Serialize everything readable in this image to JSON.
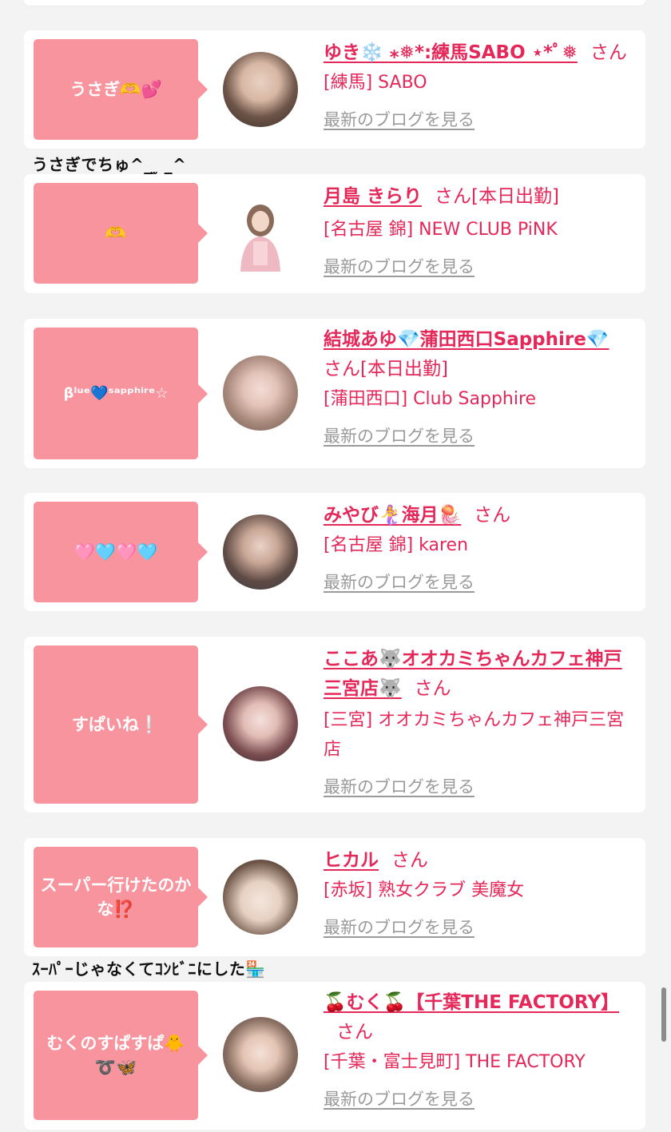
{
  "cards": [
    {
      "bubble": "うさぎ🫶💕",
      "name": "ゆき❄️ ⁎❅*:練馬SABO ⋆*ﾟ❅",
      "san": "さん",
      "status": "",
      "shop": "[練馬] SABO",
      "blog": "最新のブログを見る",
      "comment": "うさぎでちゅ^_ ̫ _^"
    },
    {
      "bubble": "🫶",
      "name": "月島 きらり",
      "san": "さん",
      "status": "[本日出勤]",
      "shop": "[名古屋 錦] NEW CLUB PiNK",
      "blog": "最新のブログを見る",
      "comment": ""
    },
    {
      "bubble": "βˡᵘᵉ💙ˢᵃᵖᵖʰⁱʳᵉ☆",
      "name": "結城あゆ💎蒲田西口Sapphire💎",
      "san": "さん",
      "status": "[本日出勤]",
      "shop": "[蒲田西口] Club Sapphire",
      "blog": "最新のブログを見る",
      "comment": ""
    },
    {
      "bubble": "🩷🩵🩷🩵",
      "name": "みやび🧜‍♀️海月🪼",
      "san": "さん",
      "status": "",
      "shop": "[名古屋 錦] karen",
      "blog": "最新のブログを見る",
      "comment": ""
    },
    {
      "bubble": "すぱいね❕",
      "name": "ここあ🐺オオカミちゃんカフェ神戸三宮店🐺",
      "san": "さん",
      "status": "",
      "shop": "[三宮] オオカミちゃんカフェ神戸三宮店",
      "blog": "最新のブログを見る",
      "comment": ""
    },
    {
      "bubble": "スーパー行けたのかな⁉️",
      "name": "ヒカル",
      "san": "さん",
      "status": "",
      "shop": "[赤坂] 熟女クラブ 美魔女",
      "blog": "最新のブログを見る",
      "comment": "ｽｰﾊﾟｰじゃなくてｺﾝﾋﾞﾆにした🏪"
    },
    {
      "bubble": "むくのすぱすぱ🐥➰🦋",
      "name": "🍒むく🍒【千葉THE FACTORY】",
      "san": "さん",
      "status": "",
      "shop": "[千葉・富士見町] THE FACTORY",
      "blog": "最新のブログを見る",
      "comment": ""
    }
  ],
  "colors": {
    "accent": "#e5285a",
    "bubble": "#f7949e",
    "link_gray": "#9a9a9a",
    "background": "#f3f3f3"
  }
}
